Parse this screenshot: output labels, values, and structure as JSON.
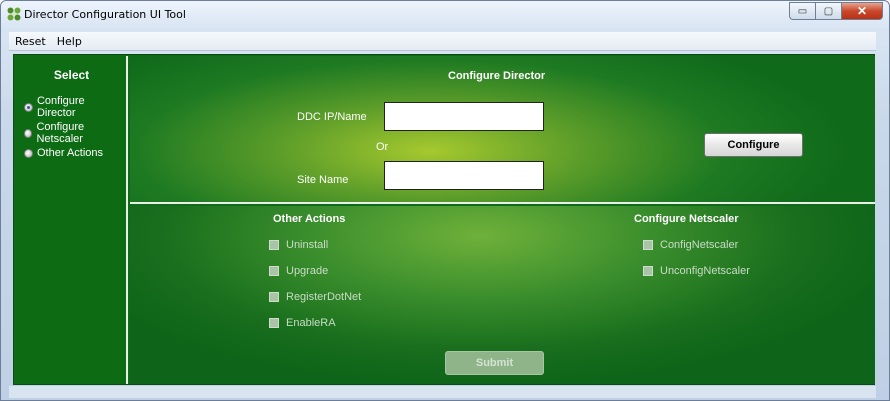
{
  "window": {
    "title": "Director Configuration UI Tool",
    "controls": {
      "minimize": "▭",
      "maximize": "▢",
      "close": "✕"
    }
  },
  "menu": {
    "items": [
      "Reset",
      "Help"
    ]
  },
  "sidebar": {
    "title": "Select",
    "options": [
      {
        "label": "Configure Director",
        "selected": true
      },
      {
        "label": "Configure Netscaler",
        "selected": false
      },
      {
        "label": "Other Actions",
        "selected": false
      }
    ]
  },
  "configure_director": {
    "heading": "Configure Director",
    "ddc_label": "DDC IP/Name",
    "ddc_value": "",
    "or_text": "Or",
    "site_label": "Site Name",
    "site_value": "",
    "configure_button": "Configure"
  },
  "other_actions": {
    "heading": "Other Actions",
    "items": [
      {
        "label": "Uninstall",
        "checked": false,
        "enabled": false
      },
      {
        "label": "Upgrade",
        "checked": false,
        "enabled": false
      },
      {
        "label": "RegisterDotNet",
        "checked": false,
        "enabled": false
      },
      {
        "label": "EnableRA",
        "checked": false,
        "enabled": false
      }
    ]
  },
  "configure_netscaler": {
    "heading": "Configure Netscaler",
    "items": [
      {
        "label": "ConfigNetscaler",
        "checked": false,
        "enabled": false
      },
      {
        "label": "UnconfigNetscaler",
        "checked": false,
        "enabled": false
      }
    ]
  },
  "submit_button": {
    "label": "Submit",
    "enabled": false
  },
  "colors": {
    "panel_green": "#0f6a1a",
    "highlight_green": "#a6c92e",
    "divider": "#e8f0e8",
    "disabled_text": "#c9dcc6"
  }
}
